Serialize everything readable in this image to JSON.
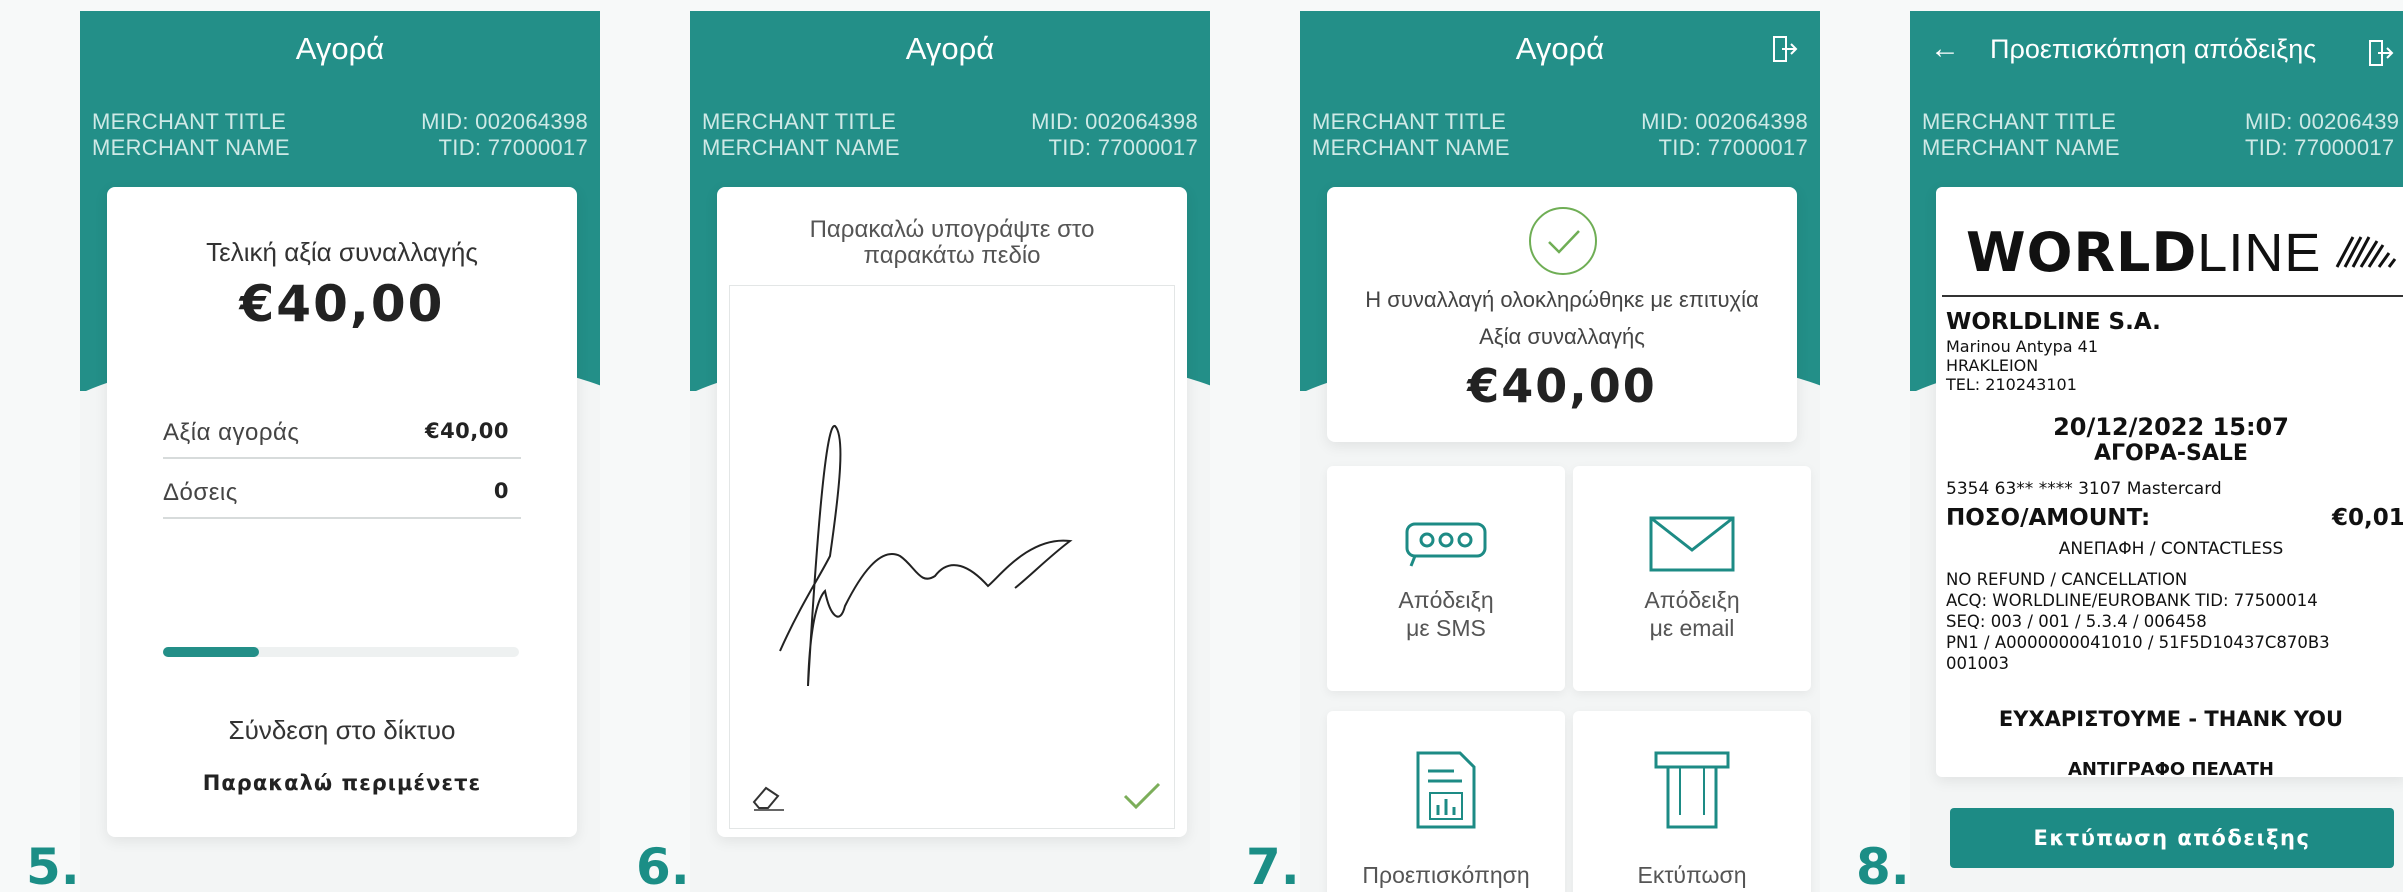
{
  "colors": {
    "teal": "#238f88",
    "step": "#1b8e86",
    "button": "#1d8b85"
  },
  "merchant": {
    "title": "MERCHANT TITLE",
    "name": "MERCHANT NAME",
    "mid": "MID: 002064398",
    "tid": "TID: 77000017",
    "mid_cut": "MID: 00206439"
  },
  "s5": {
    "num": "5.",
    "title": "Αγορά",
    "final_label": "Τελική αξία συναλλαγής",
    "amount": "€40,00",
    "rows": [
      {
        "label": "Αξία αγοράς",
        "value": "€40,00"
      },
      {
        "label": "Δόσεις",
        "value": "0"
      }
    ],
    "progress": 0.27,
    "status": "Σύνδεση στο δίκτυο",
    "wait": "Παρακαλώ περιμένετε"
  },
  "s6": {
    "num": "6.",
    "title": "Αγορά",
    "prompt_l1": "Παρακαλώ υπογράψτε στο",
    "prompt_l2": "παρακάτω πεδίο"
  },
  "s7": {
    "num": "7.",
    "title": "Αγορά",
    "success": "Η συναλλαγή ολοκληρώθηκε με επιτυχία",
    "value_label": "Αξία συναλλαγής",
    "amount": "€40,00",
    "tiles": [
      {
        "l1": "Απόδειξη",
        "l2": "με SMS"
      },
      {
        "l1": "Απόδειξη",
        "l2": "με email"
      },
      {
        "l1": "Προεπισκόπηση",
        "l2": ""
      },
      {
        "l1": "Εκτύπωση",
        "l2": ""
      }
    ]
  },
  "s8": {
    "num": "8.",
    "title": "Προεπισκόπηση απόδειξης",
    "logo_bold": "WORLD",
    "logo_light": "LINE",
    "company": "WORLDLINE S.A.",
    "addr1": "Marinou Antypa 41",
    "addr2": "HRAKLEION",
    "tel": "TEL: 210243101",
    "datetime": "20/12/2022 15:07",
    "type": "ΑΓΟΡΑ-SALE",
    "card": "5354 63** **** 3107  Mastercard",
    "amount_label": "ΠΟΣΟ/AMOUNT:",
    "amount": "€0,01",
    "contactless": "ΑΝΕΠΑΦΗ / CONTACTLESS",
    "line1": "NO REFUND / CANCELLATION",
    "line2": "ACQ: WORLDLINE/EUROBANK TID: 77500014",
    "line3": "SEQ: 003 / 001 / 5.3.4 / 006458",
    "line4": "PN1 / A0000000041010 / 51F5D10437C870B3",
    "line5": "001003",
    "thanks": "ΕΥΧΑΡΙΣΤΟΥΜΕ - THANK YOU",
    "copy": "ΑΝΤΙΓΡΑΦΟ ΠΕΛΑΤΗ",
    "print_btn": "Εκτύπωση απόδειξης"
  }
}
